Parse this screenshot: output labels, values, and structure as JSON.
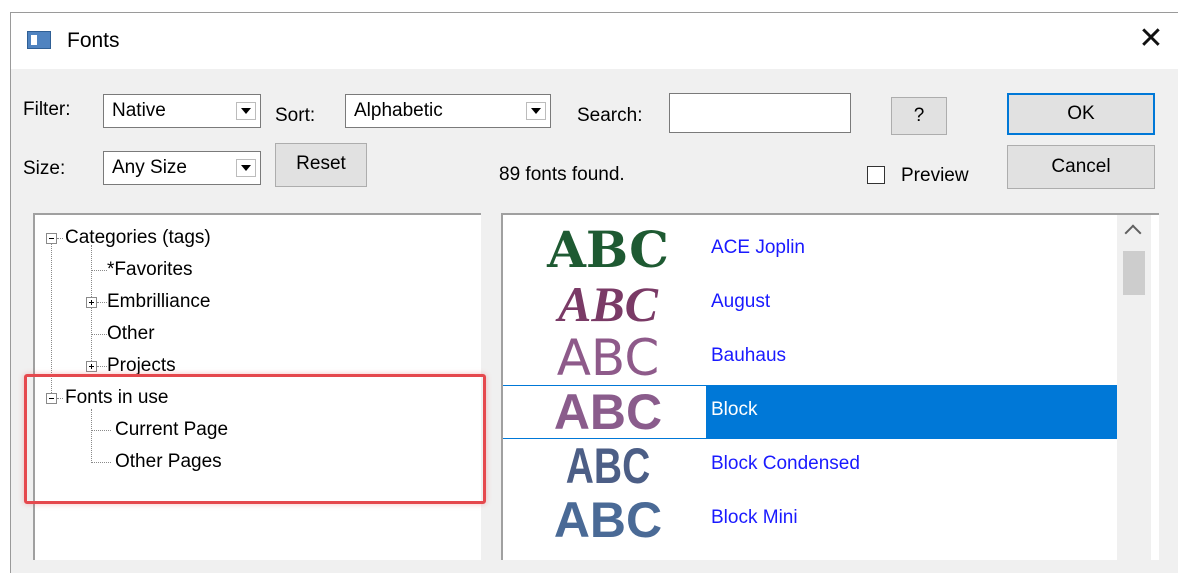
{
  "window": {
    "title": "Fonts",
    "close_glyph": "✕"
  },
  "filter": {
    "label": "Filter:",
    "value": "Native"
  },
  "sort": {
    "label": "Sort:",
    "value": "Alphabetic"
  },
  "search": {
    "label": "Search:",
    "value": ""
  },
  "help_button": {
    "label": "?"
  },
  "ok_button": {
    "label": "OK"
  },
  "cancel_button": {
    "label": "Cancel"
  },
  "size": {
    "label": "Size:",
    "value": "Any Size"
  },
  "reset_button": {
    "label": "Reset"
  },
  "status": {
    "fonts_found": "89 fonts found."
  },
  "preview": {
    "label": "Preview",
    "checked": false
  },
  "tree": {
    "categories": {
      "label": "Categories (tags)",
      "expanded": true
    },
    "favorites": {
      "label": "*Favorites"
    },
    "embrilliance": {
      "label": "Embrilliance",
      "expanded": false
    },
    "other": {
      "label": "Other"
    },
    "projects": {
      "label": "Projects",
      "expanded": false
    },
    "fonts_in_use": {
      "label": "Fonts in use",
      "expanded": true
    },
    "current_page": {
      "label": "Current Page"
    },
    "other_pages": {
      "label": "Other Pages"
    }
  },
  "fonts": [
    {
      "name": "ACE Joplin",
      "sample": "ABC",
      "sample_color": "#1e5a32",
      "selected": false
    },
    {
      "name": "August",
      "sample": "ABC",
      "sample_color": "#7a3a66",
      "selected": false
    },
    {
      "name": "Bauhaus",
      "sample": "ABC",
      "sample_color": "#8e5a8a",
      "selected": false
    },
    {
      "name": "Block",
      "sample": "ABC",
      "sample_color": "#8a5c8c",
      "selected": true
    },
    {
      "name": "Block Condensed",
      "sample": "ABC",
      "sample_color": "#4c5e86",
      "selected": false
    },
    {
      "name": "Block Mini",
      "sample": "ABC",
      "sample_color": "#4a6a96",
      "selected": false
    }
  ],
  "colors": {
    "accent": "#0078d7",
    "highlight_box": "#e5484d",
    "link": "#1a1aff"
  }
}
